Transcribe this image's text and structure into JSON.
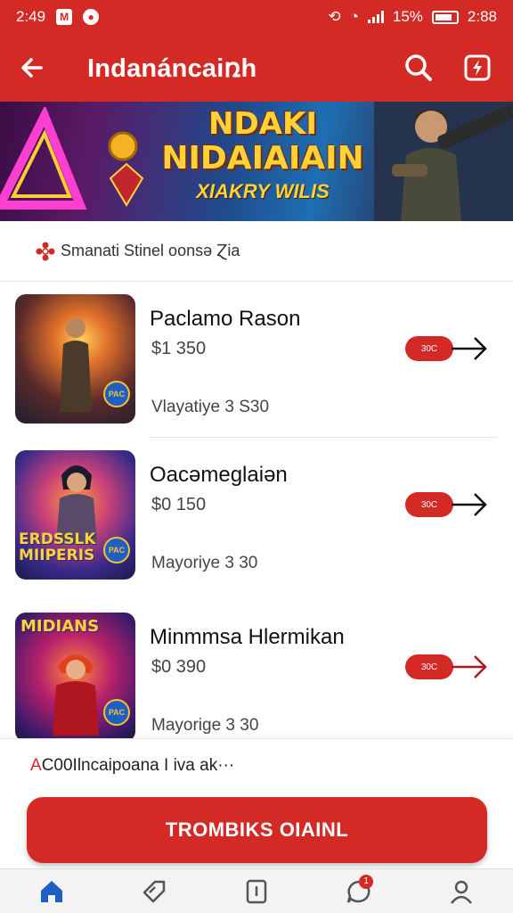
{
  "status_bar": {
    "time": "2:49",
    "battery": "15%",
    "clock_right": "2:88"
  },
  "app_bar": {
    "title": "Indanánᴄaiռh",
    "back_icon": "arrow-left-icon",
    "search_icon": "search-icon",
    "action_icon": "bolt-box-icon"
  },
  "banner": {
    "line1": "NDAKI",
    "line2": "NIDAIAIAIN",
    "sub": "XIAKRY WILIS"
  },
  "notice": {
    "text": "Smanati Stinel oonsə Ɀia",
    "icon": "flower-icon"
  },
  "games": [
    {
      "title": "Paclamo Rason",
      "price": "$1 350",
      "meta": "Vlayatiye 3 S30",
      "badge": "PAC",
      "thumb_word": ""
    },
    {
      "title": "Oacəmeglaiən",
      "price": "$0 150",
      "meta": "Mayoriye 3 30",
      "badge": "PAC",
      "thumb_word": "ERDSSLK MIIPERIS"
    },
    {
      "title": "Minmmsa Hlermikan",
      "price": "$0 390",
      "meta": "Mayorige 3 30",
      "badge": "PAC",
      "thumb_word": "MIDIANS"
    }
  ],
  "go_label": "30C",
  "footer": {
    "accent": "A",
    "text": "C00Ilncaipoana I iva ak···"
  },
  "cta_label": "TROMBIKS OIAINL",
  "nav": {
    "badge": "1",
    "items": [
      "home-icon",
      "tag-icon",
      "card-icon",
      "chat-icon",
      "profile-icon"
    ]
  },
  "colors": {
    "brand": "#d42a26",
    "nav_active": "#1f5fc4"
  }
}
